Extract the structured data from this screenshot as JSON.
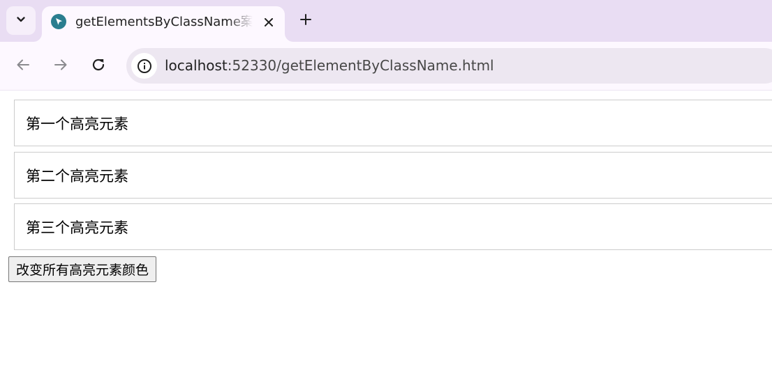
{
  "browser": {
    "tab": {
      "title": "getElementsByClassName案例",
      "favicon": "cursor-favicon-icon"
    },
    "address_bar": {
      "host": "localhost",
      "path": ":52330/getElementByClassName.html"
    },
    "icons": {
      "tab_search": "chevron-down-icon",
      "close": "close-icon",
      "new_tab": "plus-icon",
      "back": "back-arrow-icon",
      "forward": "forward-arrow-icon",
      "reload": "reload-icon",
      "site_info": "info-icon"
    },
    "colors": {
      "tabstrip_bg": "#e9ddf3",
      "toolbar_bg": "#fdf8ff",
      "omnibox_bg": "#ede7f1",
      "favicon": "#2a7e8f"
    }
  },
  "page": {
    "highlights": [
      {
        "text": "第一个高亮元素"
      },
      {
        "text": "第二个高亮元素"
      },
      {
        "text": "第三个高亮元素"
      }
    ],
    "change_button": "改变所有高亮元素颜色"
  }
}
